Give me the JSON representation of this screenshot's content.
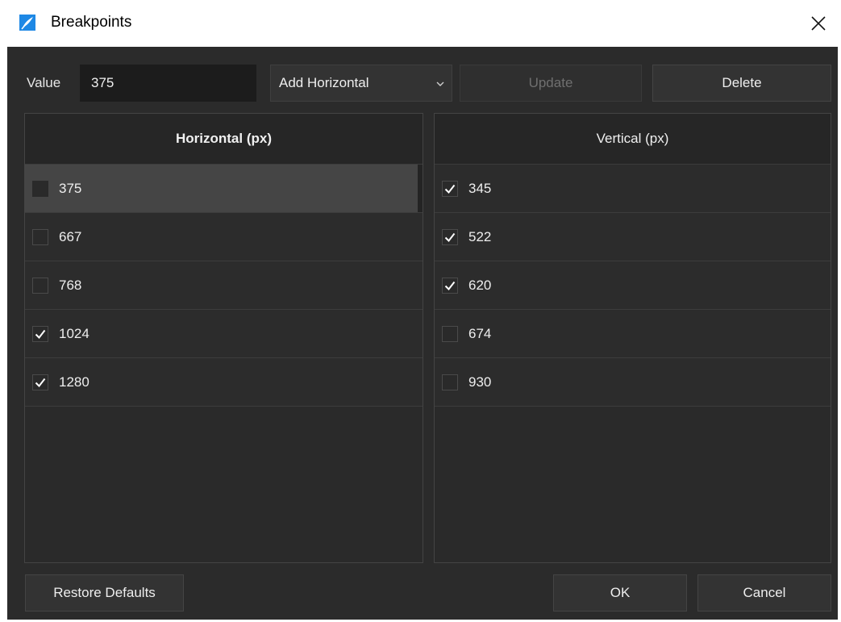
{
  "window": {
    "title": "Breakpoints"
  },
  "controls": {
    "value_label": "Value",
    "value_input": "375",
    "mode_select": "Add Horizontal",
    "update_label": "Update",
    "delete_label": "Delete"
  },
  "horizontal": {
    "header": "Horizontal (px)",
    "rows": [
      {
        "value": "375",
        "checked": false,
        "selected": true
      },
      {
        "value": "667",
        "checked": false,
        "selected": false
      },
      {
        "value": "768",
        "checked": false,
        "selected": false
      },
      {
        "value": "1024",
        "checked": true,
        "selected": false
      },
      {
        "value": "1280",
        "checked": true,
        "selected": false
      }
    ]
  },
  "vertical": {
    "header": "Vertical (px)",
    "rows": [
      {
        "value": "345",
        "checked": true
      },
      {
        "value": "522",
        "checked": true
      },
      {
        "value": "620",
        "checked": true
      },
      {
        "value": "674",
        "checked": false
      },
      {
        "value": "930",
        "checked": false
      }
    ]
  },
  "footer": {
    "restore_label": "Restore Defaults",
    "ok_label": "OK",
    "cancel_label": "Cancel"
  },
  "icons": {
    "app": "app-feather-icon",
    "close": "close-icon",
    "chevron": "chevron-down-icon",
    "check": "checkmark-icon"
  },
  "colors": {
    "background": "#2b2b2b",
    "selected_row": "#454545",
    "app_icon": "#1e88e5"
  }
}
